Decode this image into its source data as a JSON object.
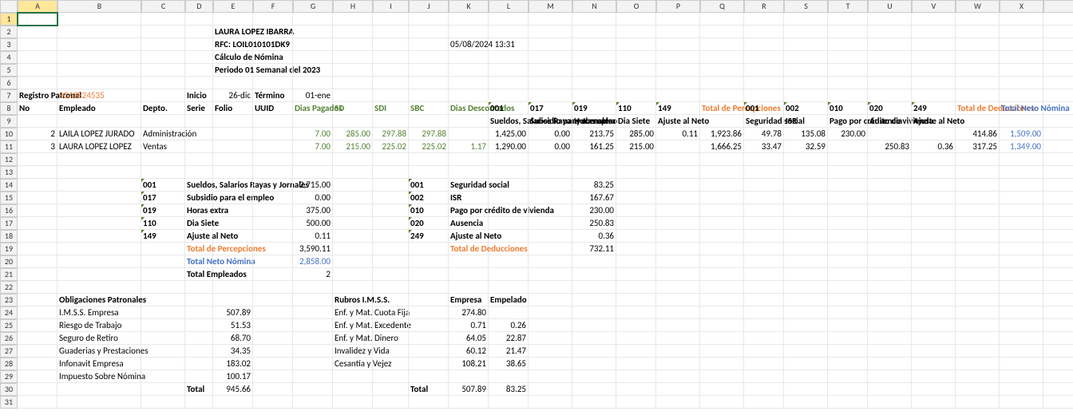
{
  "columns": [
    "",
    "A",
    "B",
    "C",
    "D",
    "E",
    "F",
    "G",
    "H",
    "I",
    "J",
    "K",
    "L",
    "M",
    "N",
    "O",
    "P",
    "Q",
    "R",
    "S",
    "T",
    "U",
    "V",
    "W",
    "X",
    "Y"
  ],
  "title": "LAURA LOPEZ IBARRA",
  "rfc": "RFC: LOIL010101DK9",
  "datetime": "05/08/2024 13:31",
  "subtitle": "Cálculo de Nómina",
  "period": "Periodo 01 Semanal del 2023",
  "reg_label": "Registro Patronal",
  "reg_val": "SGASE24535",
  "inicio_l": "Inicio",
  "inicio_v": "26-dic",
  "termino_l": "Término",
  "termino_v": "01-ene",
  "hdr": {
    "no": "No",
    "emp": "Empleado",
    "dep": "Depto.",
    "ser": "Serie",
    "fol": "Folio",
    "uuid": "UUID",
    "dp": "Dias Pagados",
    "sd": "SD",
    "sdi": "SDI",
    "sbc": "SBC",
    "dd": "Dias Descontados",
    "c001": "001",
    "c017": "017",
    "c019": "019",
    "c110": "110",
    "c149": "149",
    "tp": "Total de Percepciones",
    "d001": "001",
    "d002": "002",
    "d010": "010",
    "d020": "020",
    "d249": "249",
    "td": "Total de Deducciones",
    "tnn": "Total Neto Nómina"
  },
  "sub": {
    "c001": "Sueldos, Salarios Rayas y Jornales",
    "c017": "Subsidio para el empleo",
    "c019": "Horas extra",
    "c110": "Dia Siete",
    "c149": "Ajuste al Neto",
    "d001": "Seguridad social",
    "d002": "ISR",
    "d010": "Pago por crédito de vivienda",
    "d020": "Ausencia",
    "d249": "Ajuste al Neto"
  },
  "rows": [
    {
      "no": "2",
      "emp": "LAILA LOPEZ JURADO",
      "dep": "Administración",
      "dp": "7.00",
      "sd": "285.00",
      "sdi": "297.88",
      "sbc": "297.88",
      "dd": "",
      "c001": "1,425.00",
      "c017": "0.00",
      "c019": "213.75",
      "c110": "285.00",
      "c149": "0.11",
      "tp": "1,923.86",
      "d001": "49.78",
      "d002": "135.08",
      "d010": "230.00",
      "d020": "",
      "d249": "",
      "td": "414.86",
      "tnn": "1,509.00"
    },
    {
      "no": "3",
      "emp": "LAURA LOPEZ LOPEZ",
      "dep": "Ventas",
      "dp": "7.00",
      "sd": "215.00",
      "sdi": "225.02",
      "sbc": "225.02",
      "dd": "1.17",
      "c001": "1,290.00",
      "c017": "0.00",
      "c019": "161.25",
      "c110": "215.00",
      "c149": "",
      "tp": "1,666.25",
      "d001": "33.47",
      "d002": "32.59",
      "d010": "",
      "d020": "250.83",
      "d249": "0.36",
      "td": "317.25",
      "tnn": "1,349.00"
    }
  ],
  "perc": [
    {
      "code": "001",
      "label": "Sueldos, Salarios Rayas y Jornales",
      "val": "2,715.00"
    },
    {
      "code": "017",
      "label": "Subsidio para el empleo",
      "val": "0.00"
    },
    {
      "code": "019",
      "label": "Horas extra",
      "val": "375.00"
    },
    {
      "code": "110",
      "label": "Dia Siete",
      "val": "500.00"
    },
    {
      "code": "149",
      "label": "Ajuste al Neto",
      "val": "0.11"
    }
  ],
  "perc_total_l": "Total de Percepciones",
  "perc_total_v": "3,590.11",
  "neto_l": "Total Neto Nómina",
  "neto_v": "2,858.00",
  "emp_l": "Total Empleados",
  "emp_v": "2",
  "ded": [
    {
      "code": "001",
      "label": "Seguridad social",
      "val": "83.25"
    },
    {
      "code": "002",
      "label": "ISR",
      "val": "167.67"
    },
    {
      "code": "010",
      "label": "Pago por crédito de vivienda",
      "val": "230.00"
    },
    {
      "code": "020",
      "label": "Ausencia",
      "val": "250.83"
    },
    {
      "code": "249",
      "label": "Ajuste al Neto",
      "val": "0.36"
    }
  ],
  "ded_total_l": "Total de Deducciones",
  "ded_total_v": "732.11",
  "oblig_h": "Obligaciones Patronales",
  "oblig": [
    {
      "l": "I.M.S.S. Empresa",
      "v": "507.89"
    },
    {
      "l": "Riesgo de Trabajo",
      "v": "51.53"
    },
    {
      "l": "Seguro de Retiro",
      "v": "68.70"
    },
    {
      "l": "Guaderias y Prestaciones",
      "v": "34.35"
    },
    {
      "l": "Infonavit Empresa",
      "v": "183.02"
    },
    {
      "l": "Impuesto Sobre Nómina",
      "v": "100.17"
    }
  ],
  "oblig_total_l": "Total",
  "oblig_total_v": "945.66",
  "rubros_h": "Rubros I.M.S.S.",
  "rubros_emp": "Empresa",
  "rubros_empl": "Empelado",
  "rubros": [
    {
      "l": "Enf. y Mat. Cuota Fija",
      "e": "274.80",
      "p": ""
    },
    {
      "l": "Enf. y Mat. Excedente",
      "e": "0.71",
      "p": "0.26"
    },
    {
      "l": "Enf. y Mat. Dinero",
      "e": "64.05",
      "p": "22.87"
    },
    {
      "l": "Invalidez y Vida",
      "e": "60.12",
      "p": "21.47"
    },
    {
      "l": "Cesantía y Vejez",
      "e": "108.21",
      "p": "38.65"
    }
  ],
  "rubros_total_l": "Total",
  "rubros_total_e": "507.89",
  "rubros_total_p": "83.25"
}
